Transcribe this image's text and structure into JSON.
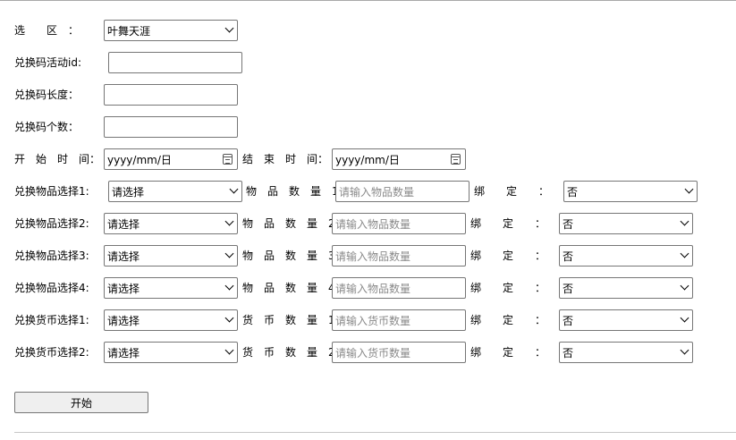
{
  "region": {
    "label": "选　　区　：",
    "value": "叶舞天涯"
  },
  "activity_id": {
    "label": "兑换码活动id:",
    "value": ""
  },
  "code_length": {
    "label": "兑换码长度：",
    "value": ""
  },
  "code_count": {
    "label": "兑换码个数：",
    "value": ""
  },
  "time": {
    "start_label": "开　始　时　间：",
    "start_value": "yyyy/mm/日",
    "end_label": "结　束　时　间：",
    "end_value": "yyyy/mm/日"
  },
  "rows": [
    {
      "select_label": "兑换物品选择1:",
      "select_value": "请选择",
      "qty_label": "物　品　数　量　1:",
      "qty_placeholder": "请输入物品数量",
      "bind_label": "绑　　定　　：",
      "bind_value": "否"
    },
    {
      "select_label": "兑换物品选择2:",
      "select_value": "请选择",
      "qty_label": "物　品　数　量　2:",
      "qty_placeholder": "请输入物品数量",
      "bind_label": "绑　　定　　：",
      "bind_value": "否"
    },
    {
      "select_label": "兑换物品选择3:",
      "select_value": "请选择",
      "qty_label": "物　品　数　量　3:",
      "qty_placeholder": "请输入物品数量",
      "bind_label": "绑　　定　　：",
      "bind_value": "否"
    },
    {
      "select_label": "兑换物品选择4:",
      "select_value": "请选择",
      "qty_label": "物　品　数　量　4:",
      "qty_placeholder": "请输入物品数量",
      "bind_label": "绑　　定　　：",
      "bind_value": "否"
    },
    {
      "select_label": "兑换货币选择1:",
      "select_value": "请选择",
      "qty_label": "货　币　数　量　1:",
      "qty_placeholder": "请输入货币数量",
      "bind_label": "绑　　定　　：",
      "bind_value": "否"
    },
    {
      "select_label": "兑换货币选择2:",
      "select_value": "请选择",
      "qty_label": "货　币　数　量　2:",
      "qty_placeholder": "请输入货币数量",
      "bind_label": "绑　　定　　：",
      "bind_value": "否"
    }
  ],
  "start_button": "开始"
}
